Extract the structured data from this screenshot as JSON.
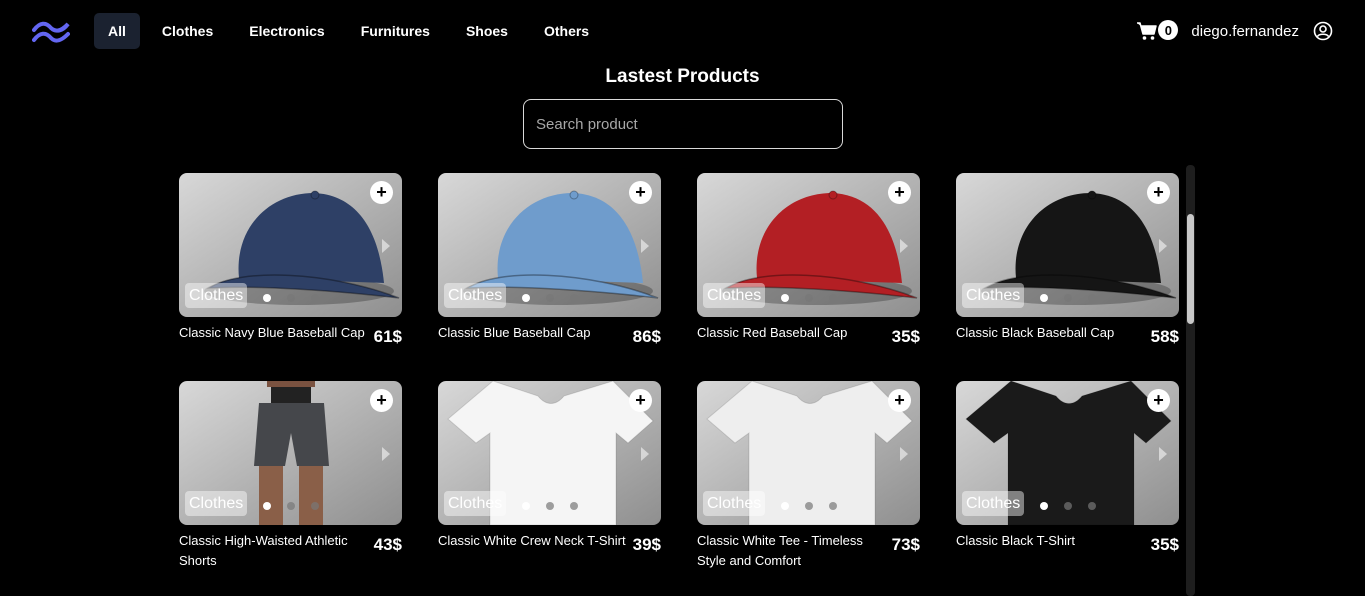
{
  "nav": {
    "links": [
      {
        "label": "All",
        "active": true
      },
      {
        "label": "Clothes",
        "active": false
      },
      {
        "label": "Electronics",
        "active": false
      },
      {
        "label": "Furnitures",
        "active": false
      },
      {
        "label": "Shoes",
        "active": false
      },
      {
        "label": "Others",
        "active": false
      }
    ],
    "cart_count": "0",
    "username": "diego.fernandez",
    "accent": "#6366f1"
  },
  "page": {
    "title": "Lastest Products",
    "search_placeholder": "Search product"
  },
  "products": [
    {
      "name": "Classic Navy Blue Baseball Cap",
      "price": "61$",
      "category": "Clothes",
      "image": "cap",
      "color": "#2e4066"
    },
    {
      "name": "Classic Blue Baseball Cap",
      "price": "86$",
      "category": "Clothes",
      "image": "cap",
      "color": "#6f9ccc"
    },
    {
      "name": "Classic Red Baseball Cap",
      "price": "35$",
      "category": "Clothes",
      "image": "cap",
      "color": "#b31f24"
    },
    {
      "name": "Classic Black Baseball Cap",
      "price": "58$",
      "category": "Clothes",
      "image": "cap",
      "color": "#151515"
    },
    {
      "name": "Classic High-Waisted Athletic Shorts",
      "price": "43$",
      "category": "Clothes",
      "image": "shorts",
      "color": "#45474b"
    },
    {
      "name": "Classic White Crew Neck T-Shirt",
      "price": "39$",
      "category": "Clothes",
      "image": "tshirt",
      "color": "#f5f5f5"
    },
    {
      "name": "Classic White Tee - Timeless Style and Comfort",
      "price": "73$",
      "category": "Clothes",
      "image": "tshirt",
      "color": "#eeeeee"
    },
    {
      "name": "Classic Black T-Shirt",
      "price": "35$",
      "category": "Clothes",
      "image": "tshirt",
      "color": "#1a1a1a"
    }
  ]
}
